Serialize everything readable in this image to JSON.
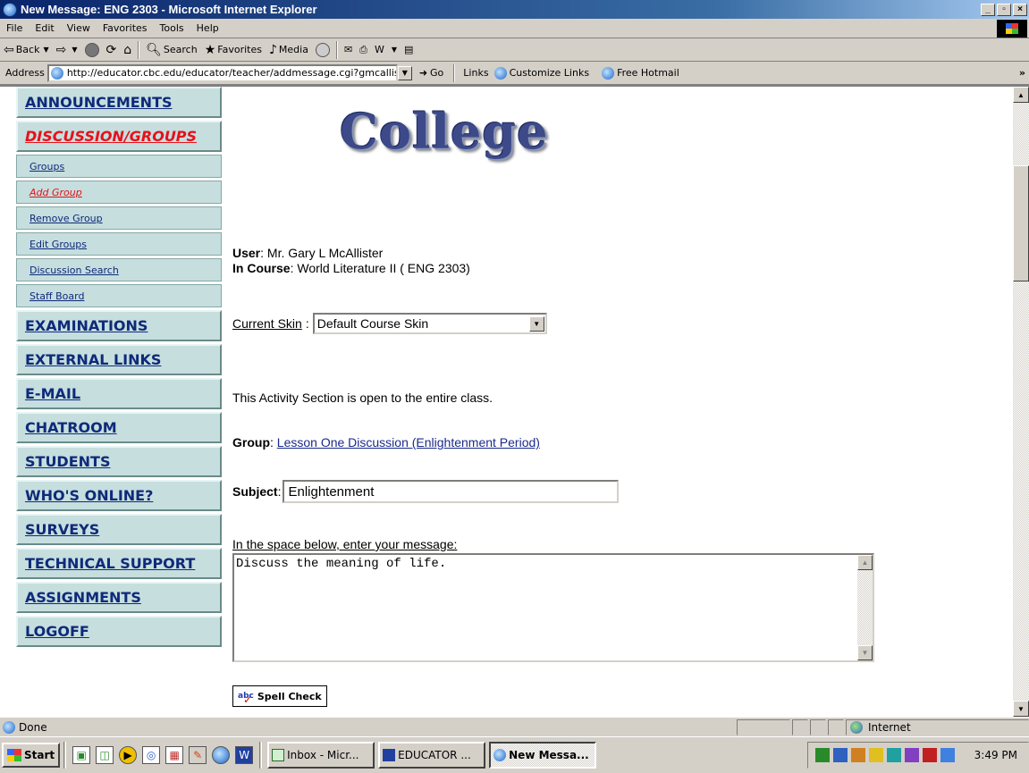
{
  "window": {
    "title": "New Message: ENG 2303 - Microsoft Internet Explorer",
    "buttons": [
      "_",
      "▫",
      "×"
    ]
  },
  "menu": [
    "File",
    "Edit",
    "View",
    "Favorites",
    "Tools",
    "Help"
  ],
  "toolbar": {
    "back": "Back",
    "search": "Search",
    "favorites": "Favorites",
    "media": "Media"
  },
  "address": {
    "label": "Address",
    "url": "http://educator.cbc.edu/educator/teacher/addmessage.cgi?gmcallister",
    "go": "Go",
    "links_label": "Links",
    "links": [
      "Customize Links",
      "Free Hotmail"
    ]
  },
  "sidebar": {
    "main_top": [
      {
        "label": "ANNOUNCEMENTS",
        "active": false
      },
      {
        "label": "DISCUSSION/GROUPS",
        "active": true
      }
    ],
    "sub": [
      {
        "label": "Groups",
        "active": false
      },
      {
        "label": "Add Group",
        "active": true
      },
      {
        "label": "Remove Group",
        "active": false
      },
      {
        "label": "Edit Groups",
        "active": false
      },
      {
        "label": "Discussion Search",
        "active": false
      },
      {
        "label": "Staff Board",
        "active": false
      }
    ],
    "main_bottom": [
      {
        "label": "EXAMINATIONS"
      },
      {
        "label": "EXTERNAL LINKS"
      },
      {
        "label": "E-MAIL"
      },
      {
        "label": "CHATROOM"
      },
      {
        "label": "STUDENTS"
      },
      {
        "label": "WHO'S ONLINE?"
      },
      {
        "label": "SURVEYS"
      },
      {
        "label": "TECHNICAL SUPPORT"
      },
      {
        "label": "ASSIGNMENTS"
      },
      {
        "label": "LOGOFF"
      }
    ]
  },
  "main": {
    "logo_text": "College",
    "user_label": "User",
    "user_value": ": Mr. Gary L McAllister",
    "course_label": "In Course",
    "course_value": ": World Literature II ( ENG 2303)",
    "skin_label": "Current Skin",
    "skin_value": "Default Course Skin",
    "open_text": "This Activity Section is open to the entire class.",
    "group_label": "Group",
    "group_value": "Lesson One Discussion (Enlightenment Period)",
    "subject_label": "Subject",
    "subject_value": "Enlightenment",
    "message_label": "In the space below, enter your message:",
    "message_value": "Discuss the meaning of life.",
    "spell_check": "Spell Check",
    "spell_icon": "abc"
  },
  "status": {
    "text": "Done",
    "zone": "Internet"
  },
  "taskbar": {
    "start": "Start",
    "tasks": [
      {
        "label": "Inbox - Micr...",
        "active": false
      },
      {
        "label": "EDUCATOR ...",
        "active": false
      },
      {
        "label": "New Messa...",
        "active": true
      }
    ],
    "clock": "3:49 PM"
  }
}
